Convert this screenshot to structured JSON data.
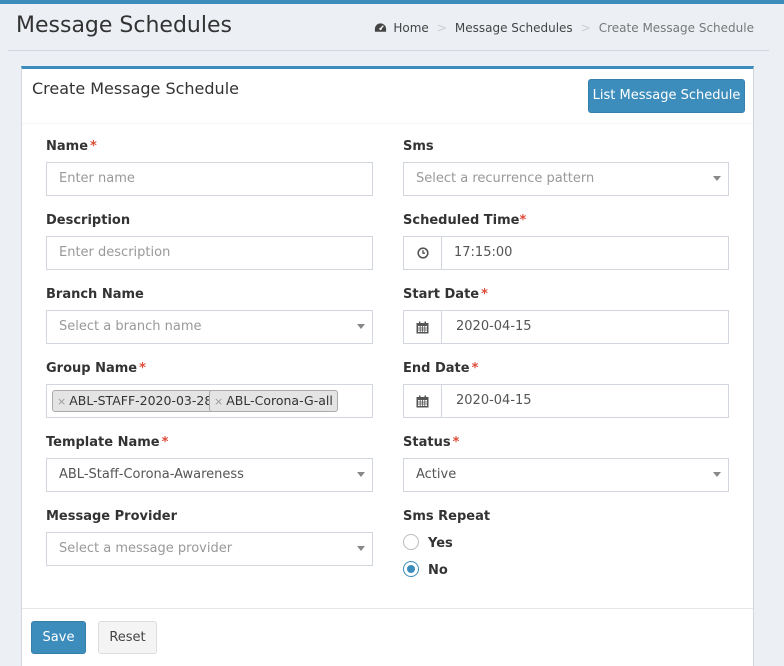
{
  "header": {
    "title": "Message Schedules",
    "breadcrumb": {
      "home": "Home",
      "section": "Message Schedules",
      "current": "Create Message Schedule"
    }
  },
  "box": {
    "title": "Create Message Schedule",
    "list_button": "List Message Schedule",
    "save_button": "Save",
    "reset_button": "Reset"
  },
  "form": {
    "required_mark": "*",
    "name": {
      "label": "Name",
      "placeholder": "Enter name"
    },
    "description": {
      "label": "Description",
      "placeholder": "Enter description"
    },
    "branch": {
      "label": "Branch Name",
      "placeholder": "Select a branch name"
    },
    "group": {
      "label": "Group Name",
      "tags": [
        "ABL-STAFF-2020-03-28",
        "ABL-Corona-G-all"
      ],
      "remove_mark": "×"
    },
    "template": {
      "label": "Template Name",
      "value": "ABL-Staff-Corona-Awareness"
    },
    "provider": {
      "label": "Message Provider",
      "placeholder": "Select a message provider"
    },
    "sms": {
      "label": "Sms",
      "placeholder": "Select a recurrence pattern"
    },
    "scheduled_time": {
      "label": "Scheduled Time",
      "value": "17:15:00"
    },
    "start_date": {
      "label": "Start Date",
      "value": "2020-04-15"
    },
    "end_date": {
      "label": "End Date",
      "value": "2020-04-15"
    },
    "status": {
      "label": "Status",
      "value": "Active"
    },
    "sms_repeat": {
      "label": "Sms Repeat",
      "options": [
        "Yes",
        "No"
      ],
      "selected": "No"
    }
  },
  "colors": {
    "primary": "#3c8dbc",
    "required": "#dd4b39",
    "background": "#ecf0f5"
  }
}
